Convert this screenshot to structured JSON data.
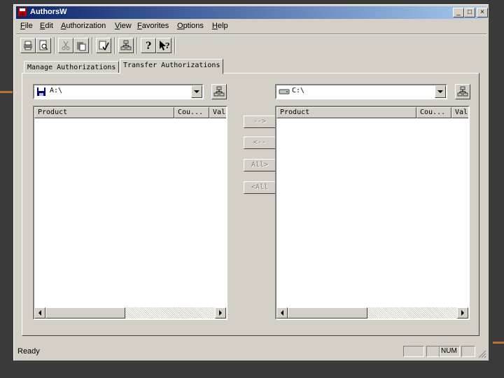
{
  "window": {
    "title": "AuthorsW",
    "minimize": "_",
    "maximize": "□",
    "close": "×"
  },
  "menu": [
    {
      "label": "File",
      "key": "F",
      "rest": "ile"
    },
    {
      "label": "Edit",
      "key": "E",
      "rest": "dit"
    },
    {
      "label": "Authorization",
      "key": "A",
      "rest": "uthorization"
    },
    {
      "label": "View",
      "key": "V",
      "rest": "iew"
    },
    {
      "label": "Favorites",
      "key": "F",
      "rest": "avorites"
    },
    {
      "label": "Options",
      "key": "O",
      "rest": "ptions"
    },
    {
      "label": "Help",
      "key": "H",
      "rest": "elp"
    }
  ],
  "toolbar": [
    "print-icon",
    "print-preview-icon",
    "cut-icon",
    "paste-icon",
    "filter-icon",
    "network-icon",
    "help-icon",
    "context-help-icon"
  ],
  "tabs": {
    "manage": "Manage Authorizations",
    "transfer": "Transfer Authorizations"
  },
  "left": {
    "drive": "A:\\",
    "columns": {
      "product": "Product",
      "count": "Cou...",
      "valid": "Vali"
    }
  },
  "right": {
    "drive": "C:\\",
    "columns": {
      "product": "Product",
      "count": "Cou...",
      "valid": "Vali"
    }
  },
  "transfer_buttons": {
    "to_right": "-->",
    "to_left": "<--",
    "all_right": "All>",
    "all_left": "<All"
  },
  "status": {
    "text": "Ready",
    "num": "NUM"
  }
}
